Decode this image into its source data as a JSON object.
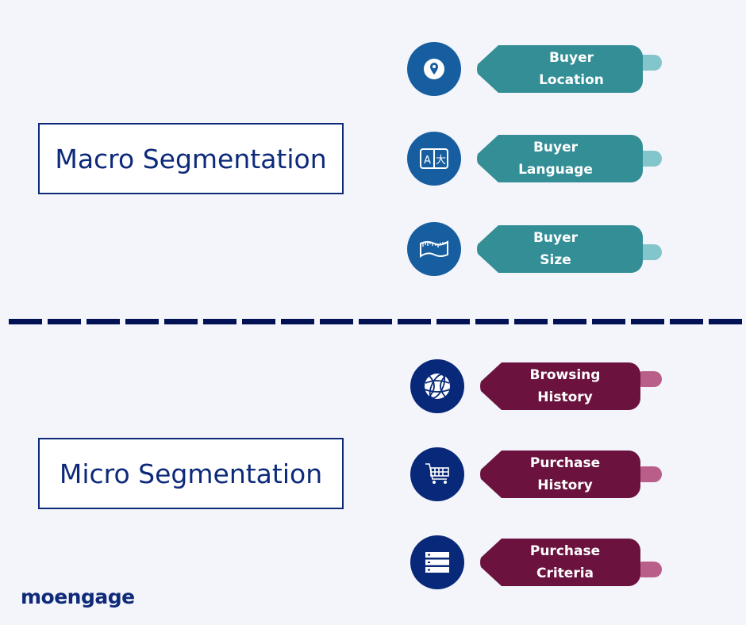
{
  "colors": {
    "background": "#f4f5fb",
    "navy": "#0d2a7a",
    "macro_circle": "#175ea1",
    "macro_tag": "#338e96",
    "macro_tab": "#82c5ca",
    "micro_circle": "#08287a",
    "micro_tag": "#6b133e",
    "micro_tab": "#b95e88"
  },
  "macro": {
    "title": "Macro Segmentation",
    "items": [
      {
        "icon": "location-pin-icon",
        "line1": "Buyer",
        "line2": "Location"
      },
      {
        "icon": "translate-icon",
        "line1": "Buyer",
        "line2": "Language"
      },
      {
        "icon": "measuring-tape-icon",
        "line1": "Buyer",
        "line2": "Size"
      }
    ]
  },
  "micro": {
    "title": "Micro Segmentation",
    "items": [
      {
        "icon": "globe-icon",
        "line1": "Browsing",
        "line2": "History"
      },
      {
        "icon": "shopping-cart-icon",
        "line1": "Purchase",
        "line2": "History"
      },
      {
        "icon": "list-icon",
        "line1": "Purchase",
        "line2": "Criteria"
      }
    ]
  },
  "logo": {
    "text": "moengage"
  }
}
